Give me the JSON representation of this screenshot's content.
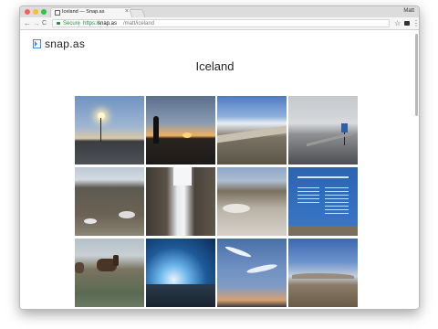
{
  "browser": {
    "tab_title": "Iceland — Snap.as",
    "tab_close": "×",
    "user": "Matt",
    "back": "←",
    "forward": "→",
    "reload": "C",
    "secure_label": "Secure",
    "url_scheme": "https://",
    "url_host": "snap.as",
    "url_path": "/matt/iceland",
    "star": "☆",
    "menu": "⋮"
  },
  "page": {
    "logo_text": "snap.as",
    "title": "Iceland"
  },
  "photos": [
    {
      "name": "photo-sunset-road"
    },
    {
      "name": "photo-silhouette-sunset"
    },
    {
      "name": "photo-snowy-hills"
    },
    {
      "name": "photo-road-sign"
    },
    {
      "name": "photo-rocky-snow"
    },
    {
      "name": "photo-rift-canyon"
    },
    {
      "name": "photo-snowy-ground"
    },
    {
      "name": "photo-info-sign"
    },
    {
      "name": "photo-horses"
    },
    {
      "name": "photo-ice-cave"
    },
    {
      "name": "photo-cloudy-sky"
    },
    {
      "name": "photo-mountains-dusk"
    }
  ]
}
